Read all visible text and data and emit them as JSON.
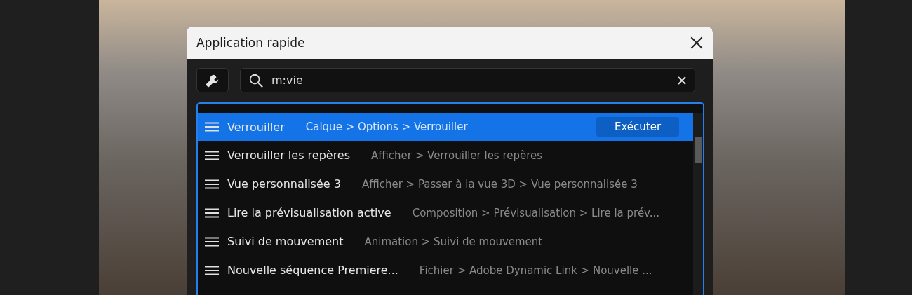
{
  "dialog": {
    "title": "Application rapide",
    "search": {
      "value": "m:vie"
    },
    "results": [
      {
        "label": "Verrouiller",
        "path": "Calque > Options > Verrouiller",
        "selected": true,
        "action": "Exécuter"
      },
      {
        "label": "Verrouiller les repères",
        "path": "Afficher > Verrouiller les repères",
        "selected": false
      },
      {
        "label": "Vue personnalisée 3",
        "path": "Afficher > Passer à la vue 3D > Vue personnalisée 3",
        "selected": false
      },
      {
        "label": "Lire la prévisualisation active",
        "path": "Composition > Prévisualisation > Lire la prév...",
        "selected": false
      },
      {
        "label": "Suivi de mouvement",
        "path": "Animation > Suivi de mouvement",
        "selected": false
      },
      {
        "label": "Nouvelle séquence Premiere...",
        "path": "Fichier > Adobe Dynamic Link > Nouvelle ...",
        "selected": false
      }
    ]
  }
}
